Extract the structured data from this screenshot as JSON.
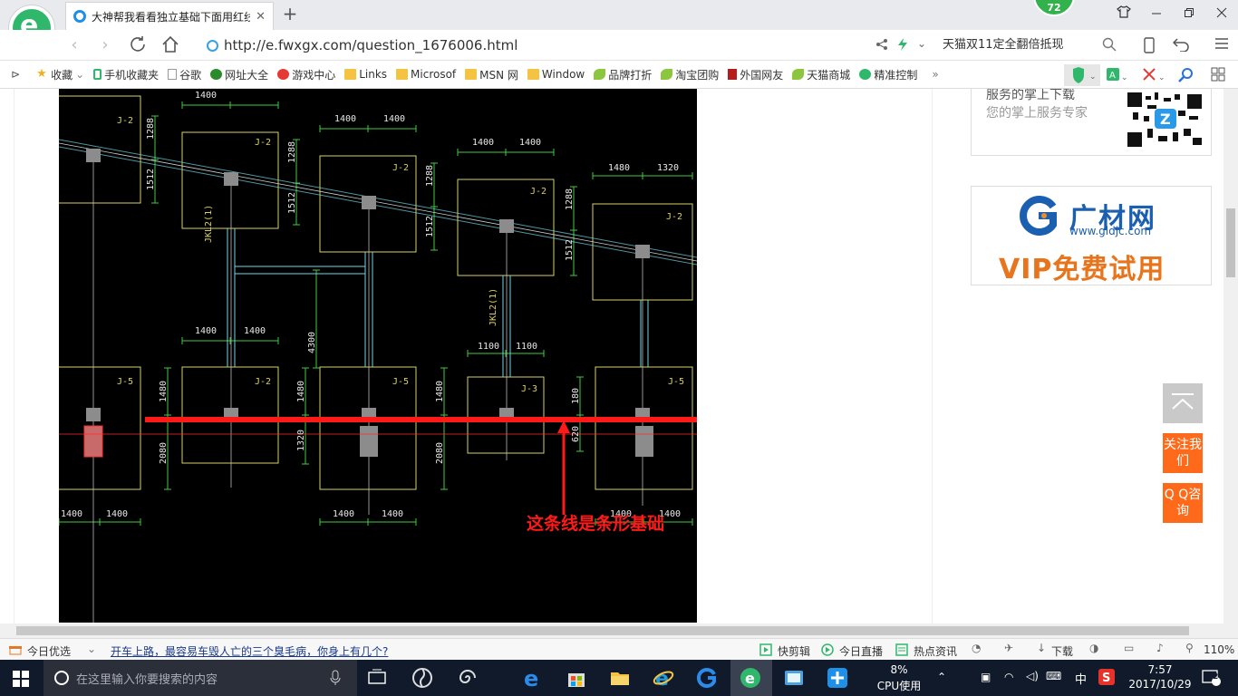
{
  "browser": {
    "tab_title": "大神帮我看看独立基础下面用红线",
    "tab_close": "✕",
    "new_tab": "+",
    "badge_count": "72",
    "url": "http://e.fwxgx.com/question_1676006.html",
    "search_text": "天猫双11定全翻倍抵现"
  },
  "bookmarks": [
    {
      "label": "收藏",
      "icon": "star-icon"
    },
    {
      "label": "手机收藏夹",
      "icon": "phone-icon"
    },
    {
      "label": "谷歌",
      "icon": "page-icon"
    },
    {
      "label": "网址大全",
      "icon": "globe-icon"
    },
    {
      "label": "游戏中心",
      "icon": "game-icon"
    },
    {
      "label": "Links",
      "icon": "folder-icon"
    },
    {
      "label": "Microsof",
      "icon": "folder-icon"
    },
    {
      "label": "MSN 网",
      "icon": "folder-icon"
    },
    {
      "label": "Window",
      "icon": "folder-icon"
    },
    {
      "label": "品牌打折",
      "icon": "leaf-icon"
    },
    {
      "label": "淘宝团购",
      "icon": "leaf-icon"
    },
    {
      "label": "外国网友",
      "icon": "flag-icon"
    },
    {
      "label": "天猫商城",
      "icon": "leaf-icon"
    },
    {
      "label": "精准控制",
      "icon": "chat-icon"
    }
  ],
  "bookmarks_more": "»",
  "sidebar": {
    "service_heading": "服务的掌上下载",
    "service_text": "您的掌上服务专家",
    "ad_brand": "广材网",
    "ad_domain": "www.gldjc.com",
    "ad_vip": "VIP免费试用",
    "follow_label": "关注我们",
    "qq_label": "Q Q咨询"
  },
  "drawing": {
    "annotation": "这条线是条形基础",
    "labels": {
      "j2": "J-2",
      "j3": "J-3",
      "j5": "J-5",
      "d1400": "1400",
      "d1480": "1480",
      "d1320": "1320",
      "d1100": "1100",
      "d1288": "1288",
      "d1512": "1512",
      "d2080": "2080",
      "d4300": "4300",
      "d180": "180",
      "d620": "620",
      "beam1": "JKL2(1)",
      "beam2": "JKL2(1)"
    }
  },
  "statusbar": {
    "daily": "今日优选",
    "headline": "开车上路，最容易车毁人亡的三个臭毛病，你身上有几个?",
    "quick_cut": "快剪辑",
    "live": "今日直播",
    "hot_news": "热点资讯",
    "download": "下载",
    "zoom": "110%"
  },
  "taskbar": {
    "search_placeholder": "在这里输入你要搜索的内容",
    "cpu_percent": "8%",
    "cpu_label": "CPU使用",
    "ime": "中",
    "time": "7:57",
    "date": "2017/10/29",
    "notifications": "2"
  },
  "colors": {
    "accent_green": "#2fb86c",
    "cad_yellow": "#d8d066",
    "cad_green": "#3fcc3f",
    "cad_cyan": "#6fd6e6",
    "annotation_red": "#ff1a1a",
    "sidebar_orange": "#ff6a1a"
  }
}
